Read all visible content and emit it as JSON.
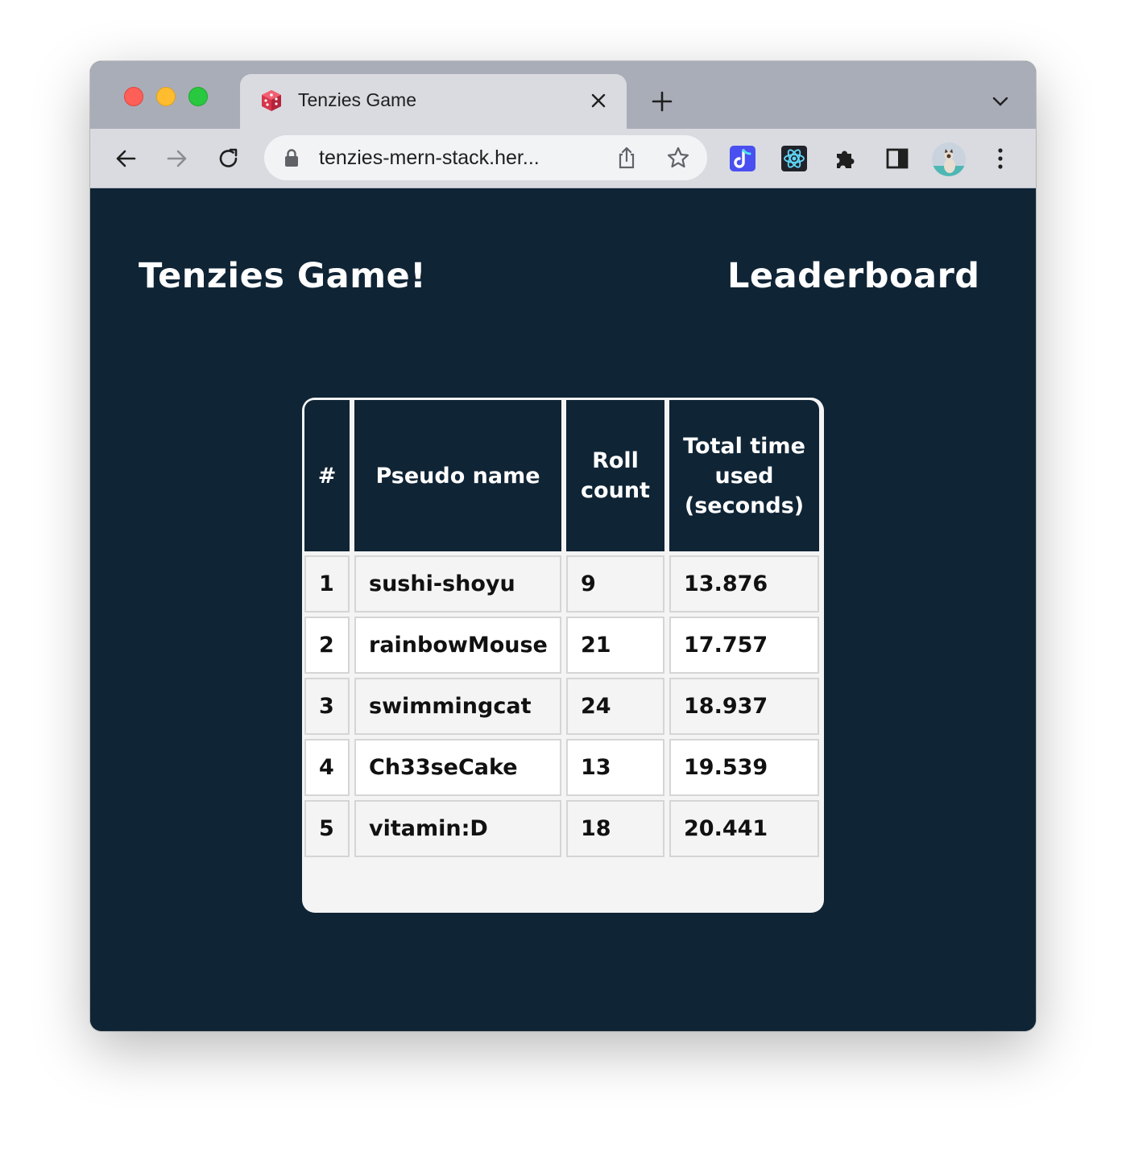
{
  "browser": {
    "tab_title": "Tenzies Game",
    "url": "tenzies-mern-stack.her...",
    "icons": [
      "dice-favicon",
      "close-icon",
      "plus-icon",
      "chevron-down-icon",
      "back-arrow-icon",
      "forward-arrow-icon",
      "reload-icon",
      "lock-icon",
      "share-icon",
      "star-icon",
      "extension-icon",
      "react-devtools-icon",
      "puzzle-icon",
      "side-panel-icon",
      "profile-avatar",
      "kebab-menu-icon"
    ]
  },
  "page": {
    "brand": "Tenzies Game!",
    "nav_link": "Leaderboard"
  },
  "leaderboard": {
    "headers": [
      "#",
      "Pseudo name",
      "Roll count",
      "Total time used (seconds)"
    ],
    "rows": [
      {
        "rank": "1",
        "name": "sushi-shoyu",
        "rolls": "9",
        "time": "13.876"
      },
      {
        "rank": "2",
        "name": "rainbowMouse",
        "rolls": "21",
        "time": "17.757"
      },
      {
        "rank": "3",
        "name": "swimmingcat",
        "rolls": "24",
        "time": "18.937"
      },
      {
        "rank": "4",
        "name": "Ch33seCake",
        "rolls": "13",
        "time": "19.539"
      },
      {
        "rank": "5",
        "name": "vitamin:D",
        "rolls": "18",
        "time": "20.441"
      }
    ]
  },
  "colors": {
    "page_background": "#0f2435",
    "table_header": "#0f2435",
    "table_row_alt": "#f4f4f4"
  }
}
